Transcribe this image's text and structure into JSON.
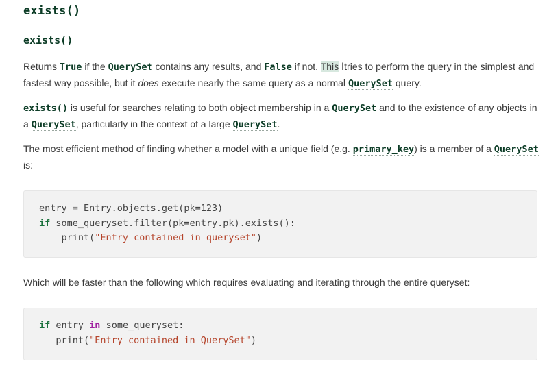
{
  "heading": "exists()",
  "signature": "exists()",
  "para1": {
    "t1": "Returns ",
    "c1": "True",
    "t2": " if the ",
    "c2": "QuerySet",
    "t3": " contains any results, and ",
    "c3": "False",
    "t4": " if not. ",
    "t4b": "This",
    "cursor": "I",
    "t5": "tries to perform the query in the simplest and fastest way possible, but it ",
    "em": "does",
    "t6": " execute nearly the same query as a normal ",
    "c4": "QuerySet",
    "t7": " query."
  },
  "para2": {
    "c1": "exists()",
    "t1": " is useful for searches relating to both object membership in a ",
    "c2": "QuerySet",
    "t2": " and to the existence of any objects in a ",
    "c3": "QuerySet",
    "t3": ", particularly in the context of a large ",
    "c4": "QuerySet",
    "t4": "."
  },
  "para3": {
    "t1": "The most efficient method of finding whether a model with a unique field (e.g. ",
    "c1": "primary_key",
    "t2": ") is a member of a ",
    "c2": "QuerySet",
    "t3": " is:"
  },
  "code1": {
    "l1_a": "entry",
    "l1_op": " = ",
    "l1_b": "Entry.objects.get(pk=123)",
    "l2_kw": "if",
    "l2_b": " some_queryset.filter(pk=entry.pk).exists():",
    "l3_a": "    print(",
    "l3_str": "\"Entry contained in queryset\"",
    "l3_b": ")"
  },
  "para4": "Which will be faster than the following which requires evaluating and iterating through the entire queryset:",
  "code2": {
    "l1_kw": "if",
    "l1_a": " entry ",
    "l1_kw2": "in",
    "l1_b": " some_queryset:",
    "l2_a": "   print(",
    "l2_str": "\"Entry contained in QuerySet\"",
    "l2_b": ")"
  }
}
